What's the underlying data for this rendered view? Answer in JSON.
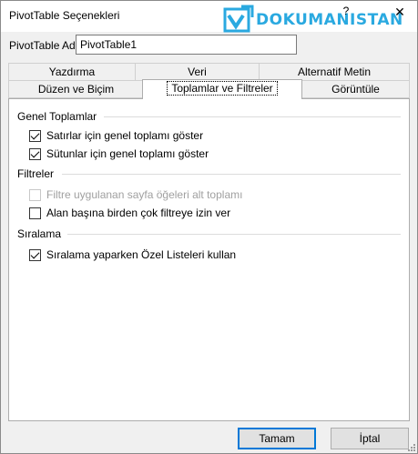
{
  "window": {
    "title": "PivotTable Seçenekleri",
    "help_symbol": "?",
    "close_symbol": "✕",
    "watermark": "DOKUMANISTAN"
  },
  "name_field": {
    "label": "PivotTable Adı:",
    "value": "PivotTable1"
  },
  "tabs": {
    "row_back": [
      {
        "label": "Yazdırma"
      },
      {
        "label": "Veri"
      },
      {
        "label": "Alternatif Metin"
      }
    ],
    "row_front": [
      {
        "label": "Düzen ve Biçim"
      },
      {
        "label": "Toplamlar ve Filtreler",
        "active": true
      },
      {
        "label": "Görüntüle"
      }
    ]
  },
  "groups": {
    "grand_totals": {
      "label": "Genel Toplamlar",
      "options": [
        {
          "label": "Satırlar için genel toplamı göster",
          "checked": true
        },
        {
          "label": "Sütunlar için genel toplamı göster",
          "checked": true
        }
      ]
    },
    "filters": {
      "label": "Filtreler",
      "options": [
        {
          "label": "Filtre uygulanan sayfa öğeleri alt toplamı",
          "checked": false,
          "disabled": true
        },
        {
          "label": "Alan başına birden çok filtreye izin ver",
          "checked": false
        }
      ]
    },
    "sorting": {
      "label": "Sıralama",
      "options": [
        {
          "label": "Sıralama yaparken Özel Listeleri kullan",
          "checked": true
        }
      ]
    }
  },
  "buttons": {
    "ok": "Tamam",
    "cancel": "İptal"
  },
  "colors": {
    "accent": "#0078d7",
    "logo": "#2aa9e0"
  }
}
